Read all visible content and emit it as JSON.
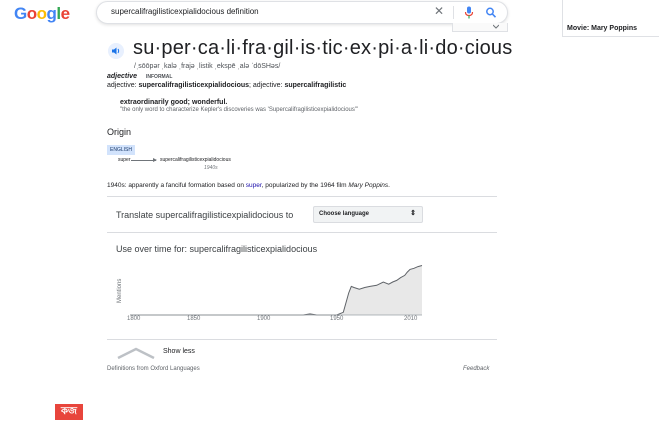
{
  "header": {
    "logo": [
      "G",
      "o",
      "o",
      "g",
      "l",
      "e"
    ],
    "logo_colors": [
      "#4285F4",
      "#EA4335",
      "#FBBC05",
      "#4285F4",
      "#34A853",
      "#EA4335"
    ],
    "search_query": "supercalifragilisticexpialidocious definition"
  },
  "knowledge_panel": {
    "movie_label": "Movie: Mary Poppins"
  },
  "dictionary": {
    "headword": "su·per·ca·li·fra·gil·is·tic·ex·pi·a·li·do·cious",
    "phonetic": "/ˌsōōpər ˌkalə ˌfrajə ˌlistik ˌekspē ˌalə ˈdōSHəs/",
    "part_of_speech": "adjective",
    "register": "INFORMAL",
    "forms_prefix": "adjective: ",
    "forms_word1": "supercalifragilisticexpialidocious",
    "forms_mid": "; adjective: ",
    "forms_word2": "supercalifragilistic",
    "definition": "extraordinarily good; wonderful.",
    "example": "\"the only word to characterize Kepler's discoveries was 'Supercalifragilisticexpialidocious'\"",
    "origin_heading": "Origin",
    "origin_lang": "ENGLISH",
    "etym_from": "super",
    "etym_to": "supercalifragilisticexpialidocious",
    "etym_date": "1940s",
    "origin_text_1": "1940s: apparently a fanciful formation based on ",
    "origin_link": "super",
    "origin_text_2": ", popularized by the 1964 film ",
    "origin_film": "Mary Poppins",
    "origin_text_3": "."
  },
  "translate": {
    "label": "Translate supercalifragilisticexpialidocious to",
    "select_value": "Choose language"
  },
  "usage": {
    "title": "Use over time for: supercalifragilisticexpialidocious",
    "ylabel": "Mentions",
    "ticks": [
      "1800",
      "1850",
      "1900",
      "1950",
      "2010"
    ]
  },
  "chart_data": {
    "type": "area",
    "title": "Use over time for: supercalifragilisticexpialidocious",
    "ylabel": "Mentions",
    "xlabel": "",
    "xlim": [
      1800,
      2019
    ],
    "ylim": [
      0,
      1
    ],
    "x": [
      1800,
      1900,
      1930,
      1935,
      1940,
      1955,
      1960,
      1964,
      1966,
      1968,
      1972,
      1976,
      1980,
      1985,
      1990,
      1994,
      1997,
      2000,
      2003,
      2006,
      2008,
      2010,
      2013,
      2016,
      2019
    ],
    "series": [
      {
        "values": [
          0,
          0,
          0,
          0.02,
          0,
          0,
          0.05,
          0.4,
          0.52,
          0.5,
          0.47,
          0.5,
          0.52,
          0.54,
          0.6,
          0.56,
          0.6,
          0.63,
          0.68,
          0.72,
          0.78,
          0.83,
          0.85,
          0.88,
          0.9
        ]
      }
    ],
    "accent": "#5f6368",
    "fill": "#e8e8e8"
  },
  "footer": {
    "show_less": "Show less",
    "source": "Definitions from Oxford Languages",
    "feedback": "Feedback"
  },
  "badge": {
    "label": "কজ"
  }
}
